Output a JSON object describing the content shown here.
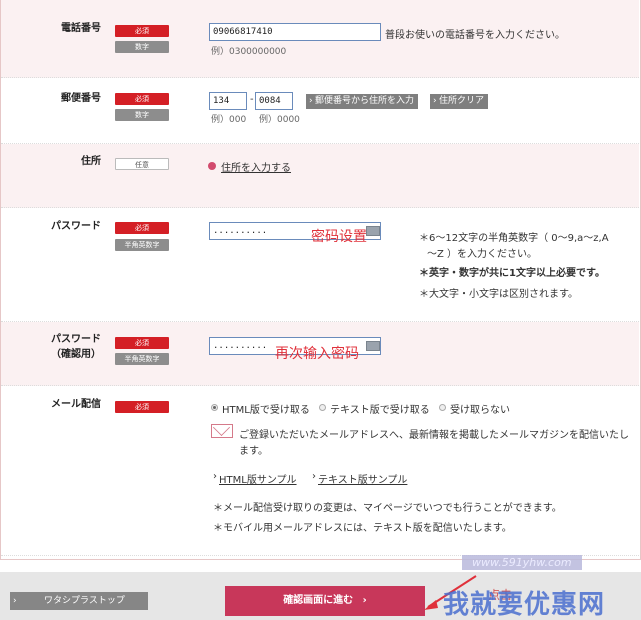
{
  "form": {
    "phone": {
      "label": "電話番号",
      "badge_required": "必須",
      "badge_type": "数字",
      "value": "09066817410",
      "help": "普段お使いの電話番号を入力ください。",
      "example": "例）0300000000"
    },
    "postal": {
      "label": "郵便番号",
      "badge_required": "必須",
      "badge_type": "数字",
      "value1": "134",
      "dash": "-",
      "value2": "0084",
      "example1": "例）000",
      "example2": "例）0000",
      "lookup_button": "郵便番号から住所を入力",
      "clear_button": "住所クリア"
    },
    "address": {
      "label": "住所",
      "badge_optional": "任意",
      "link": "住所を入力する"
    },
    "password": {
      "label": "パスワード",
      "badge_required": "必須",
      "badge_type": "半角英数字",
      "value": "..........",
      "overlay": "密码设置",
      "rule1_line1": "＊6～12文字の半角英数字（ 0～9,a～z,A",
      "rule1_line2": "～Z ）を入力ください。",
      "rule2": "＊英字・数字が共に1文字以上必要です。",
      "rule3": "＊大文字・小文字は区別されます。"
    },
    "password_confirm": {
      "label_line1": "パスワード",
      "label_line2": "（確認用）",
      "badge_required": "必須",
      "badge_type": "半角英数字",
      "value": "..........",
      "overlay": "再次输入密码"
    },
    "mail": {
      "label": "メール配信",
      "badge_required": "必須",
      "options": [
        "HTML版で受け取る",
        "テキスト版で受け取る",
        "受け取らない"
      ],
      "selected": "HTML版で受け取る",
      "notice_line1": "ご登録いただいたメールアドレスへ、最新情報を掲載したメールマガジンを配信いたし",
      "notice_line2": "ます。",
      "sample_html": "HTML版サンプル",
      "sample_text": "テキスト版サンプル",
      "note1": "＊メール配信受け取りの変更は、マイページでいつでも行うことができます。",
      "note2": "＊モバイル用メールアドレスには、テキスト版を配信いたします。"
    }
  },
  "footer": {
    "back_button": "ワタシプラストップ",
    "confirm_button": "確認画面に進む",
    "confirm_arrow": "›",
    "overlay_click": "点击",
    "watermark_url": "www.591yhw.com",
    "watermark_text": "我就要优惠网"
  },
  "colors": {
    "required": "#d41f25",
    "confirm_button": "#c8375a",
    "row_pink": "#fbf1f2"
  }
}
